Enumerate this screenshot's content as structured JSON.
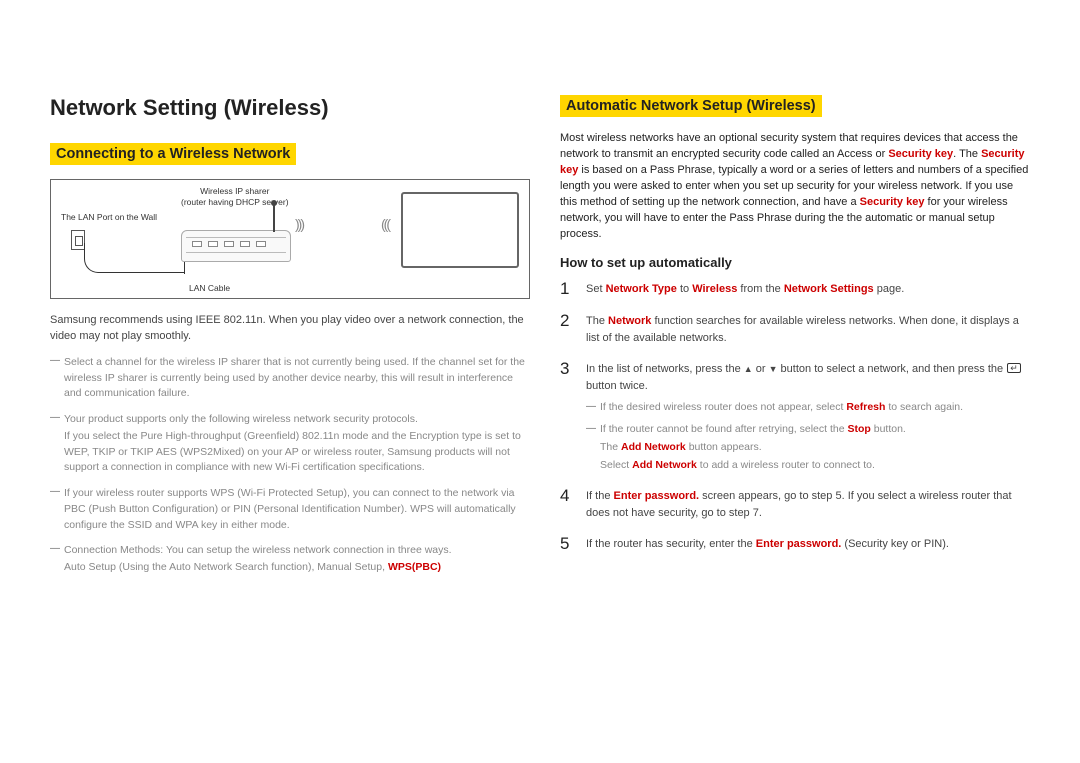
{
  "left": {
    "title": "Network Setting (Wireless)",
    "heading": "Connecting to a Wireless Network",
    "diagram": {
      "sharer_label_l1": "Wireless IP sharer",
      "sharer_label_l2": "(router having DHCP server)",
      "wall_label": "The LAN Port on the Wall",
      "cable_label": "LAN Cable"
    },
    "intro": "Samsung recommends using IEEE 802.11n. When you play video over a network connection, the video may not play smoothly.",
    "bullets": [
      {
        "main": "Select a channel for the wireless IP sharer that is not currently being used. If the channel set for the wireless IP sharer is currently being used by another device nearby, this will result in interference and communication failure."
      },
      {
        "main": "Your product supports only the following wireless network security protocols.",
        "sub": "If you select the Pure High-throughput (Greenfield) 802.11n mode and the Encryption type is set to WEP, TKIP or TKIP AES (WPS2Mixed) on your AP or wireless router, Samsung products will not support a connection in compliance with new Wi-Fi certification specifications."
      },
      {
        "main": "If your wireless router supports WPS (Wi-Fi Protected Setup), you can connect to the network via PBC (Push Button Configuration) or PIN (Personal Identification Number). WPS will automatically configure the SSID and WPA key in either mode."
      },
      {
        "main": "Connection Methods: You can setup the wireless network connection in three ways.",
        "sub_pre": "Auto Setup (Using the Auto Network Search function), Manual Setup, ",
        "sub_bold": "WPS(PBC)"
      }
    ]
  },
  "right": {
    "heading": "Automatic Network Setup (Wireless)",
    "intro_parts": {
      "p1": "Most wireless networks have an optional security system that requires devices that access the network to transmit an encrypted security code called an Access or ",
      "sk1": "Security key",
      "p2": ". The ",
      "sk2": "Security key",
      "p3": " is based on a Pass Phrase, typically a word or a series of letters and numbers of a specified length you were asked to enter when you set up security for your wireless network. If you use this method of setting up the network connection, and have a ",
      "sk3": "Security key",
      "p4": " for your wireless network, you will have to enter the Pass Phrase during the the automatic or manual setup process."
    },
    "subheading": "How to set up automatically",
    "steps": {
      "s1": {
        "pre": "Set ",
        "b1": "Network Type",
        "mid1": " to ",
        "b2": "Wireless",
        "mid2": " from the ",
        "b3": "Network Settings",
        "post": " page."
      },
      "s2": {
        "pre": "The ",
        "b1": "Network",
        "post": " function searches for available wireless networks. When done, it displays a list of the available networks."
      },
      "s3": {
        "pre": "In the list of networks, press the ",
        "mid1": " or ",
        "mid2": " button to select a network, and then press the ",
        "post": " button twice.",
        "sub1_pre": "If the desired wireless router does not appear, select ",
        "sub1_b": "Refresh",
        "sub1_post": " to search again.",
        "sub2_pre": "If the router cannot be found after retrying, select the ",
        "sub2_b": "Stop",
        "sub2_post": " button.",
        "sub3_pre": "The ",
        "sub3_b": "Add Network",
        "sub3_post": " button appears.",
        "sub4_pre": "Select ",
        "sub4_b": "Add Network",
        "sub4_post": " to add a wireless router to connect to."
      },
      "s4": {
        "pre": "If the ",
        "b1": "Enter password.",
        "post": " screen appears, go to step 5. If you select a wireless router that does not have security, go to step 7."
      },
      "s5": {
        "pre": "If the router has security, enter the ",
        "b1": "Enter password.",
        "post": " (Security key or PIN)."
      }
    }
  }
}
